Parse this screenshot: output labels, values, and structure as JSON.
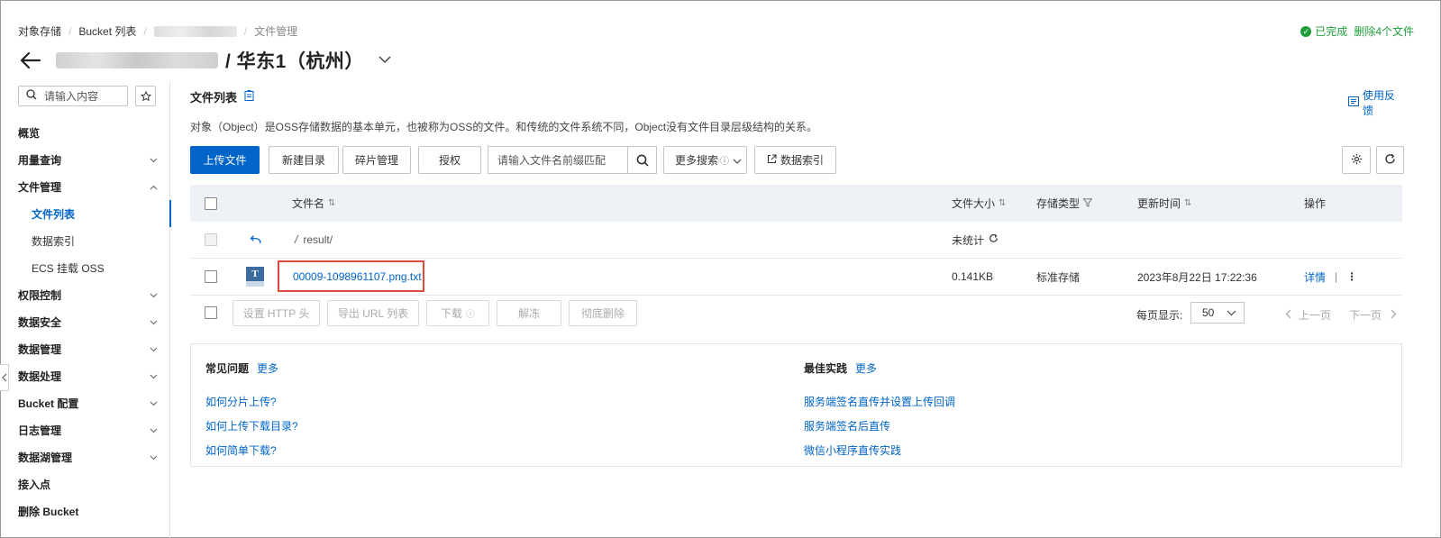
{
  "breadcrumb": {
    "items": [
      "对象存储",
      "Bucket 列表"
    ],
    "current": "文件管理"
  },
  "status": {
    "icon": "check-circle-icon",
    "text": "已完成",
    "action": "删除4个文件"
  },
  "title": {
    "region": "/ 华东1（杭州）"
  },
  "sidebar": {
    "search_placeholder": "请输入内容",
    "items": [
      {
        "label": "概览",
        "chevron": ""
      },
      {
        "label": "用量查询",
        "chevron": "down"
      },
      {
        "label": "文件管理",
        "chevron": "up"
      },
      {
        "label": "文件列表",
        "sub": true,
        "active": true
      },
      {
        "label": "数据索引",
        "sub": true
      },
      {
        "label": "ECS 挂载 OSS",
        "sub": true
      },
      {
        "label": "权限控制",
        "chevron": "down"
      },
      {
        "label": "数据安全",
        "chevron": "down"
      },
      {
        "label": "数据管理",
        "chevron": "down"
      },
      {
        "label": "数据处理",
        "chevron": "down"
      },
      {
        "label": "Bucket 配置",
        "chevron": "down"
      },
      {
        "label": "日志管理",
        "chevron": "down"
      },
      {
        "label": "数据湖管理",
        "chevron": "down"
      },
      {
        "label": "接入点",
        "chevron": ""
      },
      {
        "label": "删除 Bucket",
        "chevron": ""
      }
    ]
  },
  "main": {
    "title": "文件列表",
    "feedback": "使用反馈",
    "description": "对象（Object）是OSS存储数据的基本单元，也被称为OSS的文件。和传统的文件系统不同，Object没有文件目录层级结构的关系。"
  },
  "toolbar": {
    "upload": "上传文件",
    "new_dir": "新建目录",
    "fragments": "碎片管理",
    "authorize": "授权",
    "search_placeholder": "请输入文件名前缀匹配",
    "more_search": "更多搜索",
    "data_index": "数据索引"
  },
  "table": {
    "headers": {
      "name": "文件名",
      "size": "文件大小",
      "storage": "存储类型",
      "updated": "更新时间",
      "actions": "操作"
    },
    "parent_row": {
      "path": "result/",
      "size": "未统计"
    },
    "rows": [
      {
        "name": "00009-1098961107.png.txt",
        "icon_letter": "T",
        "size": "0.141KB",
        "storage": "标准存储",
        "updated": "2023年8月22日 17:22:36",
        "detail": "详情",
        "separator": "|"
      }
    ]
  },
  "footer": {
    "set_http_header": "设置 HTTP 头",
    "export_url": "导出 URL 列表",
    "download": "下载",
    "unfreeze": "解冻",
    "delete_all": "彻底删除",
    "per_page_label": "每页显示:",
    "per_page": "50",
    "prev": "上一页",
    "next": "下一页"
  },
  "help": {
    "faq": {
      "title": "常见问题",
      "more": "更多",
      "links": [
        "如何分片上传?",
        "如何上传下载目录?",
        "如何简单下载?"
      ]
    },
    "best": {
      "title": "最佳实践",
      "more": "更多",
      "links": [
        "服务端签名直传并设置上传回调",
        "服务端签名后直传",
        "微信小程序直传实践"
      ]
    }
  },
  "colors": {
    "primary": "#0064c8",
    "success": "#1e9e3a",
    "highlight": "#e04a3a"
  }
}
